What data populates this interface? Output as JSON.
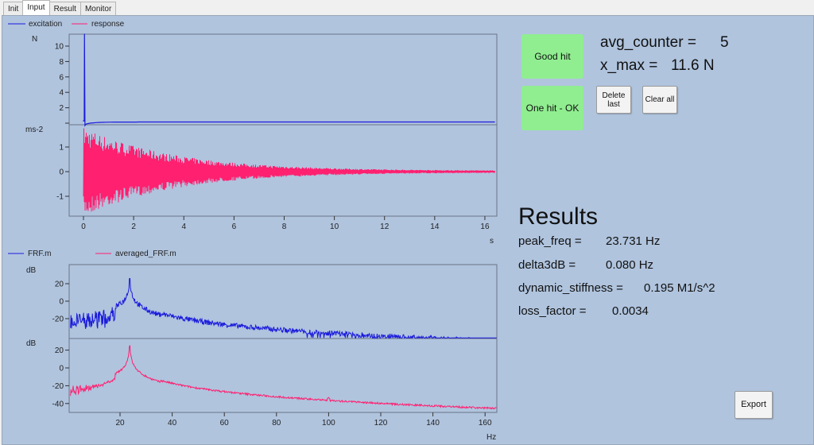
{
  "tabs": [
    "Init",
    "Input",
    "Result",
    "Monitor"
  ],
  "active_tab": "Input",
  "time_plot": {
    "legend": [
      {
        "name": "excitation",
        "color": "#1a1adc"
      },
      {
        "name": "response",
        "color": "#ff2070"
      }
    ],
    "excitation_unit": "N",
    "response_unit": "ms-2",
    "x_unit": "s",
    "excitation_yticks": [
      "10",
      "8",
      "6",
      "4",
      "2",
      "0"
    ],
    "response_yticks": [
      "1",
      "0",
      "-1"
    ],
    "xticks": [
      "0",
      "2",
      "4",
      "6",
      "8",
      "10",
      "12",
      "14",
      "16"
    ]
  },
  "frf_plot": {
    "legend": [
      {
        "name": "FRF.m",
        "color": "#1a1adc"
      },
      {
        "name": "averaged_FRF.m",
        "color": "#ff2070"
      }
    ],
    "top_unit": "dB",
    "bottom_unit": "dB",
    "x_unit": "Hz",
    "top_yticks": [
      "20",
      "0",
      "-20"
    ],
    "bottom_yticks": [
      "20",
      "0",
      "-20",
      "-40"
    ],
    "xticks": [
      "20",
      "40",
      "60",
      "80",
      "100",
      "120",
      "140",
      "160"
    ]
  },
  "chart_data": [
    {
      "type": "line",
      "xlabel": "s",
      "ylabel": "N",
      "series": [
        {
          "name": "excitation",
          "peak": 11.6,
          "peak_x": 0.05
        }
      ],
      "xlim": [
        -0.6,
        16.5
      ],
      "ylim": [
        -0.2,
        11.5
      ]
    },
    {
      "type": "line",
      "xlabel": "s",
      "ylabel": "ms-2",
      "series": [
        {
          "name": "response",
          "initial_amplitude": 1.8
        }
      ],
      "xlim": [
        -0.6,
        16.5
      ],
      "ylim": [
        -1.8,
        1.9
      ]
    },
    {
      "type": "line",
      "xlabel": "Hz",
      "ylabel": "dB",
      "series": [
        {
          "name": "FRF.m",
          "peak_freq": 23.7,
          "peak_db": 35
        }
      ],
      "xlim": [
        0.5,
        164.5
      ],
      "ylim": [
        -42,
        42
      ]
    },
    {
      "type": "line",
      "xlabel": "Hz",
      "ylabel": "dB",
      "series": [
        {
          "name": "averaged_FRF.m",
          "peak_freq": 23.7,
          "peak_db": 33
        }
      ],
      "xlim": [
        0.5,
        164.5
      ],
      "ylim": [
        -50,
        34
      ]
    }
  ],
  "status": {
    "good_hit": "Good hit",
    "one_hit": "One hit - OK",
    "status_color": "#90ee90"
  },
  "counter": {
    "avg_counter_label": "avg_counter =",
    "avg_counter_value": "5",
    "x_max_label": "x_max =",
    "x_max_value": "11.6 N"
  },
  "buttons": {
    "delete_last": "Delete last",
    "clear_all": "Clear all",
    "export": "Export"
  },
  "results": {
    "title": "Results",
    "rows": [
      {
        "label": "peak_freq =",
        "value": "23.731 Hz"
      },
      {
        "label": "delta3dB =",
        "value": "0.080 Hz"
      },
      {
        "label": "dynamic_stiffness =",
        "value": "0.195 M1/s^2"
      },
      {
        "label": "loss_factor =",
        "value": "0.0034"
      }
    ]
  }
}
